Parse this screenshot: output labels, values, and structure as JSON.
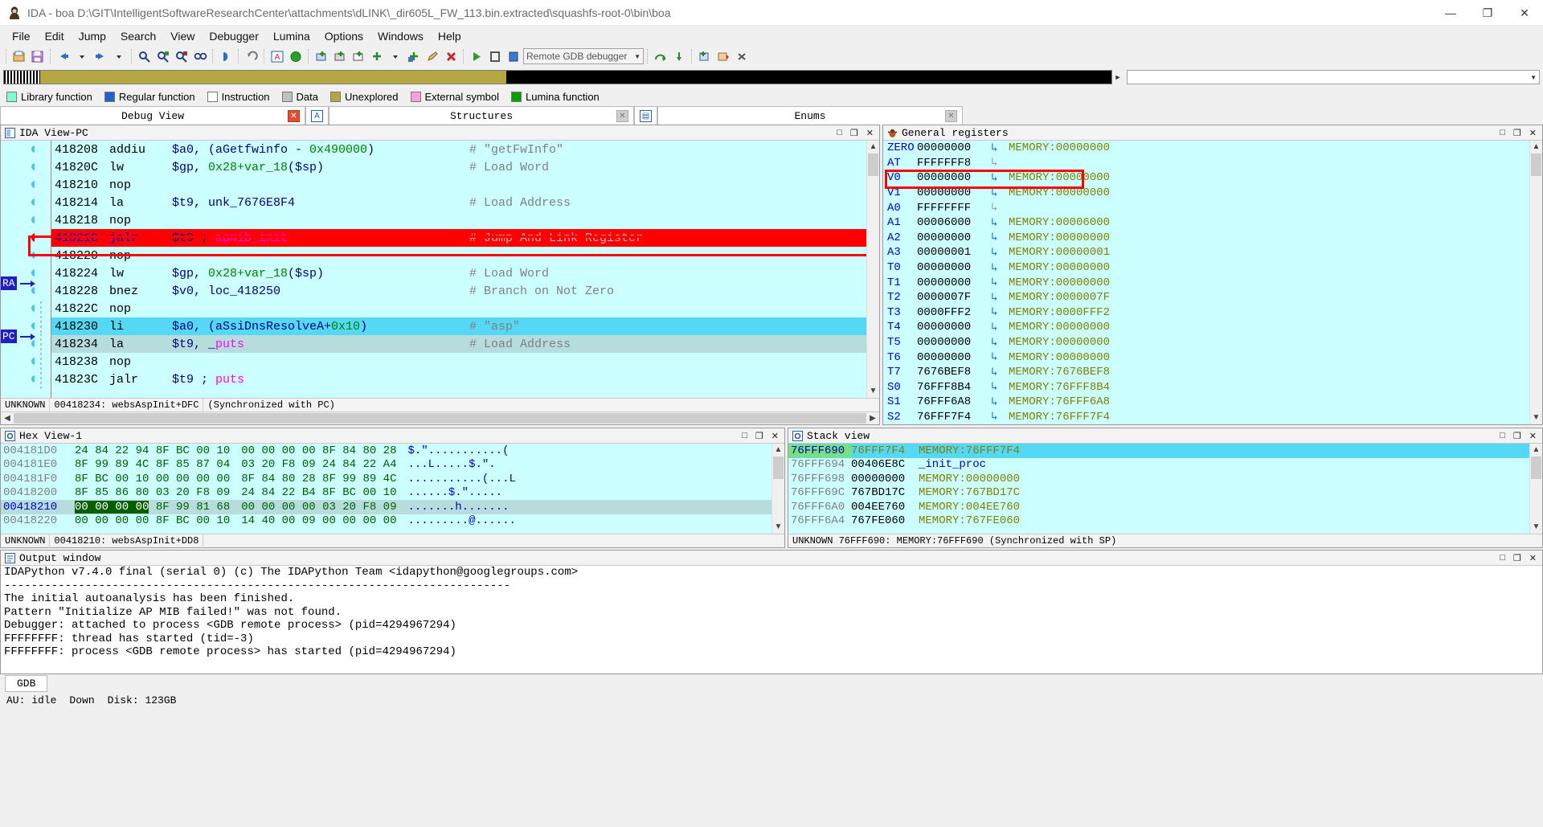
{
  "window": {
    "title": "IDA - boa D:\\GIT\\IntelligentSoftwareResearchCenter\\attachments\\dLINK\\_dir605L_FW_113.bin.extracted\\squashfs-root-0\\bin\\boa",
    "app_icon": "ida-logo-icon",
    "minimize": "—",
    "maximize": "❐",
    "close": "✕"
  },
  "menu": [
    {
      "label": "File"
    },
    {
      "label": "Edit"
    },
    {
      "label": "Jump"
    },
    {
      "label": "Search"
    },
    {
      "label": "View"
    },
    {
      "label": "Debugger"
    },
    {
      "label": "Lumina"
    },
    {
      "label": "Options"
    },
    {
      "label": "Windows"
    },
    {
      "label": "Help"
    }
  ],
  "toolbar": {
    "debugger_combo": "Remote GDB debugger",
    "buttons": [
      "open-file-icon",
      "save-icon",
      "back-icon",
      "back-dropdown-icon",
      "forward-icon",
      "forward-dropdown-icon",
      "search-icon",
      "search-next-icon",
      "search-prev-icon",
      "binary-search-icon",
      "jump-icon",
      "undo-icon",
      "ida-view-icon",
      "graph-view-icon",
      "breakpoint-add-icon",
      "breakpoint-list-icon",
      "breakpoint-edit-icon",
      "bp-plus-icon",
      "bp-dropdown-icon",
      "bp-cond-icon",
      "bp-pen-icon",
      "bp-delete-icon",
      "run-icon",
      "pause-icon",
      "stop-icon",
      "step-over-icon",
      "step-into-icon",
      "step-out-icon",
      "run-to-cursor-icon",
      "detach-icon"
    ]
  },
  "navband": {
    "combo_placeholder": ""
  },
  "legend": [
    {
      "label": "Library function",
      "color": "#7fffd4"
    },
    {
      "label": "Regular function",
      "color": "#4169e1"
    },
    {
      "label": "Instruction",
      "color": "#ffffff"
    },
    {
      "label": "Data",
      "color": "#bdbdbd"
    },
    {
      "label": "Unexplored",
      "color": "#b5a642"
    },
    {
      "label": "External symbol",
      "color": "#ff9ed8"
    },
    {
      "label": "Lumina function",
      "color": "#00a000"
    }
  ],
  "tabs": [
    {
      "label": "Debug View",
      "active": true,
      "close": "✕"
    },
    {
      "label": "",
      "icon": "structures-tab-icon",
      "active": false
    },
    {
      "label": "Structures",
      "active": false,
      "close": "✕"
    },
    {
      "label": "",
      "icon": "enums-tab-icon",
      "active": false
    },
    {
      "label": "Enums",
      "active": false,
      "close": "✕"
    }
  ],
  "disassembly": {
    "panel_title": "IDA View-PC",
    "panel_icon": "ida-view-icon",
    "win_buttons": {
      "restore": "□",
      "float": "❐",
      "close": "✕"
    },
    "status": {
      "segment": "UNKNOWN",
      "location": "00418234: websAspInit+DFC",
      "sync": "(Synchronized with PC)"
    },
    "badges": [
      {
        "name": "ra-badge",
        "label": "RA"
      },
      {
        "name": "pc-badge",
        "label": "PC"
      }
    ],
    "lines": [
      {
        "addr": "418208",
        "mnem": "addiu",
        "ops": "$a0, (aGetfwinfo - 0x490000)",
        "comment": "# \"getFwInfo\"",
        "style": "normal",
        "dot": "cyan"
      },
      {
        "addr": "41820C",
        "mnem": "lw",
        "ops": "$gp, 0x28+var_18($sp)",
        "comment": "# Load Word",
        "style": "normal",
        "dot": "cyan"
      },
      {
        "addr": "418210",
        "mnem": "nop",
        "ops": "",
        "comment": "",
        "style": "normal",
        "dot": "cyan"
      },
      {
        "addr": "418214",
        "mnem": "la",
        "ops": "$t9, unk_7676E8F4",
        "comment": "# Load Address",
        "style": "normal",
        "dot": "cyan"
      },
      {
        "addr": "418218",
        "mnem": "nop",
        "ops": "",
        "comment": "",
        "style": "normal",
        "dot": "cyan"
      },
      {
        "addr": "41821C",
        "mnem": "jalr",
        "ops": "$t9 ; apmib_init",
        "comment": "# Jump And Link Register",
        "style": "breakpoint",
        "dot": "red"
      },
      {
        "addr": "418220",
        "mnem": "nop",
        "ops": "",
        "comment": "",
        "style": "normal",
        "dot": "cyan"
      },
      {
        "addr": "418224",
        "mnem": "lw",
        "ops": "$gp, 0x28+var_18($sp)",
        "comment": "# Load Word",
        "style": "normal",
        "dot": "cyan"
      },
      {
        "addr": "418228",
        "mnem": "bnez",
        "ops": "$v0, loc_418250",
        "comment": "# Branch on Not Zero",
        "style": "normal",
        "dot": "cyan"
      },
      {
        "addr": "41822C",
        "mnem": "nop",
        "ops": "",
        "comment": "",
        "style": "normal",
        "dot": "cyan"
      },
      {
        "addr": "418230",
        "mnem": "li",
        "ops": "$a0, (aSsiDnsResolveA+0x10)",
        "comment": "# \"asp\"",
        "style": "pc",
        "dot": "cyan"
      },
      {
        "addr": "418234",
        "mnem": "la",
        "ops": "$t9, _puts",
        "comment": "# Load Address",
        "style": "pc2",
        "dot": "cyan"
      },
      {
        "addr": "418238",
        "mnem": "nop",
        "ops": "",
        "comment": "",
        "style": "normal",
        "dot": "cyan"
      },
      {
        "addr": "41823C",
        "mnem": "jalr",
        "ops": "$t9 ; puts",
        "comment": "",
        "style": "normal",
        "dot": "cyan"
      }
    ]
  },
  "registers": {
    "panel_title": "General registers",
    "panel_icon": "debugger-bug-icon",
    "win_buttons": {
      "restore": "□",
      "float": "❐",
      "close": "✕"
    },
    "highlight_register": "V0",
    "rows": [
      {
        "name": "ZERO",
        "value": "00000000",
        "arrow": "blue",
        "mem": "MEMORY:00000000"
      },
      {
        "name": "AT",
        "value": "FFFFFFF8",
        "arrow": "gray",
        "mem": ""
      },
      {
        "name": "V0",
        "value": "00000000",
        "arrow": "blue",
        "mem": "MEMORY:00000000"
      },
      {
        "name": "V1",
        "value": "00000000",
        "arrow": "blue",
        "mem": "MEMORY:00000000"
      },
      {
        "name": "A0",
        "value": "FFFFFFFF",
        "arrow": "gray",
        "mem": ""
      },
      {
        "name": "A1",
        "value": "00006000",
        "arrow": "blue",
        "mem": "MEMORY:00006000"
      },
      {
        "name": "A2",
        "value": "00000000",
        "arrow": "blue",
        "mem": "MEMORY:00000000"
      },
      {
        "name": "A3",
        "value": "00000001",
        "arrow": "blue",
        "mem": "MEMORY:00000001"
      },
      {
        "name": "T0",
        "value": "00000000",
        "arrow": "blue",
        "mem": "MEMORY:00000000"
      },
      {
        "name": "T1",
        "value": "00000000",
        "arrow": "blue",
        "mem": "MEMORY:00000000"
      },
      {
        "name": "T2",
        "value": "0000007F",
        "arrow": "blue",
        "mem": "MEMORY:0000007F"
      },
      {
        "name": "T3",
        "value": "0000FFF2",
        "arrow": "blue",
        "mem": "MEMORY:0000FFF2"
      },
      {
        "name": "T4",
        "value": "00000000",
        "arrow": "blue",
        "mem": "MEMORY:00000000"
      },
      {
        "name": "T5",
        "value": "00000000",
        "arrow": "blue",
        "mem": "MEMORY:00000000"
      },
      {
        "name": "T6",
        "value": "00000000",
        "arrow": "blue",
        "mem": "MEMORY:00000000"
      },
      {
        "name": "T7",
        "value": "7676BEF8",
        "arrow": "blue",
        "mem": "MEMORY:7676BEF8"
      },
      {
        "name": "S0",
        "value": "76FFF8B4",
        "arrow": "blue",
        "mem": "MEMORY:76FFF8B4"
      },
      {
        "name": "S1",
        "value": "76FFF6A8",
        "arrow": "blue",
        "mem": "MEMORY:76FFF6A8"
      },
      {
        "name": "S2",
        "value": "76FFF7F4",
        "arrow": "blue",
        "mem": "MEMORY:76FFF7F4"
      }
    ]
  },
  "hexview": {
    "panel_title": "Hex View-1",
    "panel_icon": "hex-view-icon",
    "win_buttons": {
      "restore": "□",
      "float": "❐",
      "close": "✕"
    },
    "status": {
      "segment": "UNKNOWN",
      "location": "00418210: websAspInit+DD8"
    },
    "rows": [
      {
        "addr": "004181D0",
        "b1": "24 84 22 94 8F BC 00 10",
        "b2": "00 00 00 00 8F 84 80 28",
        "ascii": "$.\"...........(",
        "selected": false,
        "sel_bytes": 0
      },
      {
        "addr": "004181E0",
        "b1": "8F 99 89 4C 8F 85 87 04",
        "b2": "03 20 F8 09 24 84 22 A4",
        "ascii": "...L.....$.\".",
        "selected": false,
        "sel_bytes": 0
      },
      {
        "addr": "004181F0",
        "b1": "8F BC 00 10 00 00 00 00",
        "b2": "8F 84 80 28 8F 99 89 4C",
        "ascii": "...........(...L",
        "selected": false,
        "sel_bytes": 0
      },
      {
        "addr": "00418200",
        "b1": "8F 85 86 80 03 20 F8 09",
        "b2": "24 84 22 B4 8F BC 00 10",
        "ascii": "......$.\".....",
        "selected": false,
        "sel_bytes": 0
      },
      {
        "addr": "00418210",
        "b1": "00 00 00 00 8F 99 81 68",
        "b2": "00 00 00 00 03 20 F8 09",
        "ascii": ".......h.......",
        "selected": true,
        "sel_bytes": 4
      },
      {
        "addr": "00418220",
        "b1": "00 00 00 00 8F BC 00 10",
        "b2": "14 40 00 09 00 00 00 00",
        "ascii": ".........@......",
        "selected": false,
        "sel_bytes": 0
      }
    ]
  },
  "stackview": {
    "panel_title": "Stack view",
    "panel_icon": "stack-view-icon",
    "win_buttons": {
      "restore": "□",
      "float": "❐",
      "close": "✕"
    },
    "status": {
      "text": "UNKNOWN 76FFF690: MEMORY:76FFF690 (Synchronized with SP)"
    },
    "rows": [
      {
        "addr": "76FFF690",
        "value": "76FFF7F4",
        "comment": "MEMORY:76FFF7F4",
        "selected": true
      },
      {
        "addr": "76FFF694",
        "value": "00406E8C",
        "comment": "_init_proc",
        "selected": false,
        "symbol": true
      },
      {
        "addr": "76FFF698",
        "value": "00000000",
        "comment": "MEMORY:00000000",
        "selected": false
      },
      {
        "addr": "76FFF69C",
        "value": "767BD17C",
        "comment": "MEMORY:767BD17C",
        "selected": false
      },
      {
        "addr": "76FFF6A0",
        "value": "004EE760",
        "comment": "MEMORY:004EE760",
        "selected": false
      },
      {
        "addr": "76FFF6A4",
        "value": "767FE060",
        "comment": "MEMORY:767FE060",
        "selected": false
      }
    ]
  },
  "output": {
    "panel_title": "Output window",
    "panel_icon": "output-window-icon",
    "win_buttons": {
      "restore": "□",
      "float": "❐",
      "close": "✕"
    },
    "lines": [
      "IDAPython v7.4.0 final (serial 0) (c) The IDAPython Team <idapython@googlegroups.com>",
      "---------------------------------------------------------------------------",
      "The initial autoanalysis has been finished.",
      "Pattern \"Initialize AP MIB failed!\" was not found.",
      "Debugger: attached to process <GDB remote process> (pid=4294967294)",
      "FFFFFFFF: thread has started (tid=-3)",
      "FFFFFFFF: process <GDB remote process> has started (pid=4294967294)"
    ],
    "tab_label": "GDB"
  },
  "statusbar": {
    "au": "AU: idle",
    "direction": "Down",
    "disk": "Disk: 123GB"
  },
  "colors": {
    "breakpoint_row": "#ff0000",
    "pc_row": "#55d8f5",
    "pc_row_secondary": "#b6dcdc",
    "view_background": "#ccffff",
    "highlight_border": "#ff0000",
    "register_name": "#0000dd",
    "memory_label": "#808000",
    "hex_bytes": "#006000"
  }
}
